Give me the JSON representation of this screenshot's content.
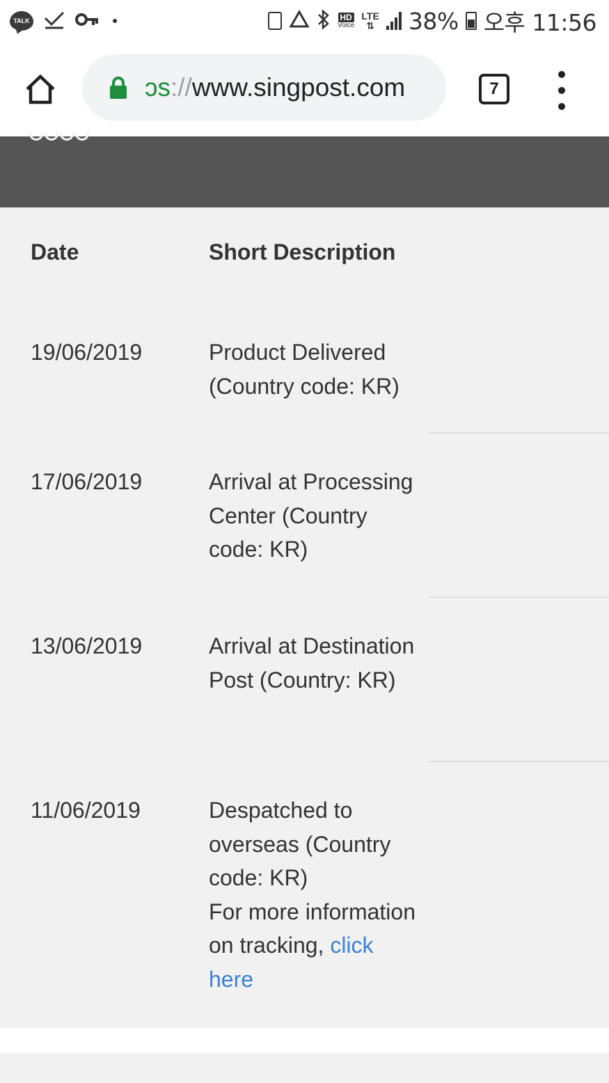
{
  "status_bar": {
    "talk_badge": "TALK",
    "battery_percent": "38%",
    "time": "오후 11:56",
    "hd_label": "HD",
    "voice_label": "Voice",
    "lte_label": "LTE",
    "icons": [
      "kakaotalk-icon",
      "check-icon",
      "key-icon",
      "dot-icon",
      "battery-saver-icon",
      "recycle-icon",
      "bluetooth-icon",
      "hd-voice-icon",
      "lte-icon",
      "signal-icon",
      "battery-icon"
    ]
  },
  "browser": {
    "url_scheme_fragment": "ɔs",
    "url_separator": "://",
    "url_host": "www.singpost.com",
    "tab_count": "7",
    "secure_color": "#1e8e3e"
  },
  "table": {
    "headers": {
      "date": "Date",
      "description": "Short Description"
    },
    "rows": [
      {
        "date": "19/06/2019",
        "description": "Product Delivered (Country code: KR)"
      },
      {
        "date": "17/06/2019",
        "description": "Arrival at Processing Center (Country code: KR)"
      },
      {
        "date": "13/06/2019",
        "description": "Arrival at Destination Post (Country: KR)"
      },
      {
        "date": "11/06/2019",
        "description": "Despatched to overseas (Country code: KR)",
        "extra_text": "For more information on tracking,",
        "link_text": "click here"
      }
    ]
  },
  "colors": {
    "header_band": "#555555",
    "panel_bg": "#f1f1f1",
    "link": "#3b82d6"
  }
}
